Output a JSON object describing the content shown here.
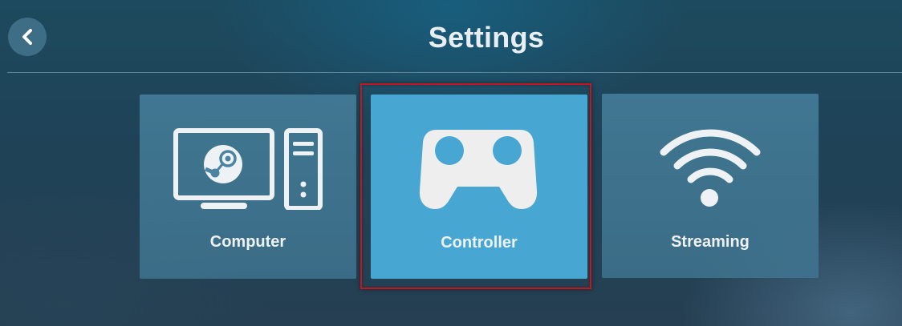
{
  "header": {
    "title": "Settings",
    "back_icon": "chevron-left-icon"
  },
  "tiles": [
    {
      "label": "Computer",
      "icon": "computer-icon",
      "selected": false
    },
    {
      "label": "Controller",
      "icon": "gamepad-icon",
      "selected": true
    },
    {
      "label": "Streaming",
      "icon": "wifi-icon",
      "selected": false
    }
  ],
  "colors": {
    "tile_active": "#48a7d2",
    "tile_inactive": "#4a84a0",
    "selection_border": "#c4161c",
    "text": "#eef2f4"
  }
}
